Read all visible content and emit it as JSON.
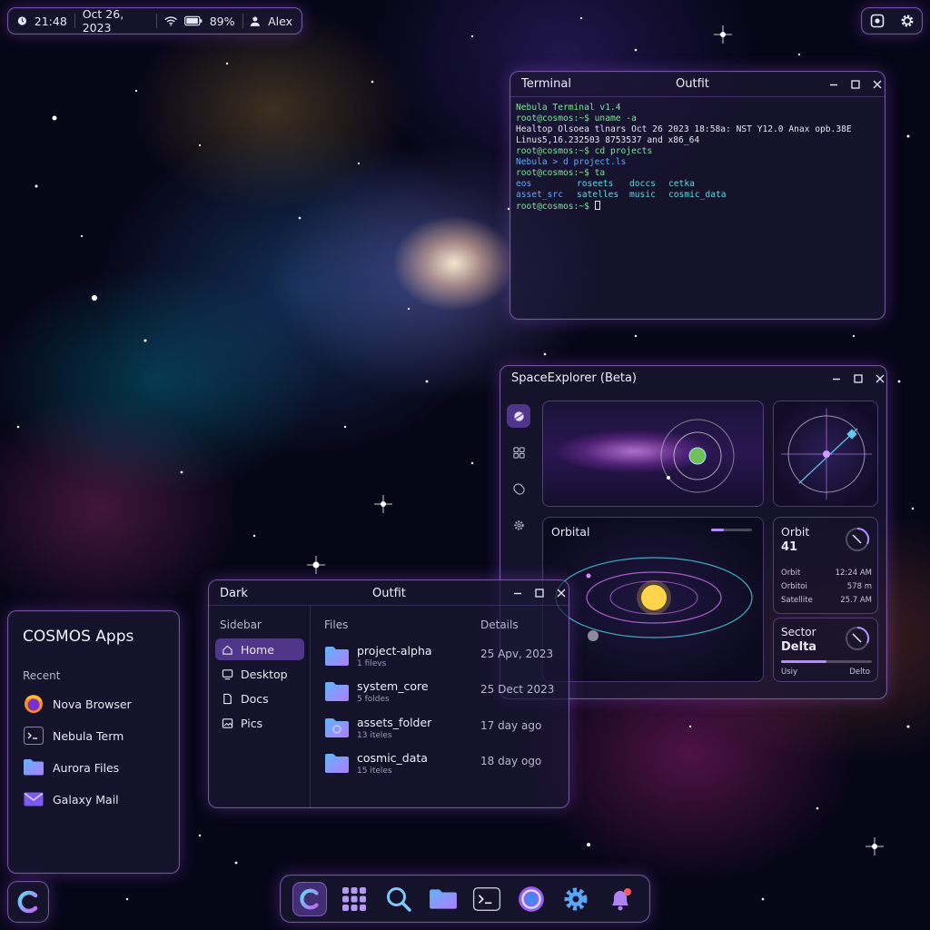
{
  "status_bar": {
    "time": "21:48",
    "date": "Oct 26, 2023",
    "battery": "89%",
    "user": "Alex"
  },
  "terminal": {
    "title_left": "Terminal",
    "title_center": "Outfit",
    "lines": {
      "l1": "Nebula Terminal v1.4",
      "l2": "root@cosmos:~$ uname -a",
      "l3": "Healtop Olsoea tlnars Oct 26 2023 18:58a: NST Y12.0 Anax opb.38E",
      "l4": "Linus5,16.232503 8753537 and x86_64",
      "l5": "root@cosmos:~$ cd projects",
      "l6": "Nebula > d project.ls",
      "l7": "root@cosmos:~$ ta",
      "l8_a": "eos",
      "l8_b": "roseets",
      "l8_c": "doccs",
      "l8_d": "cetka",
      "l9_a": "asset_src",
      "l9_b": "satelles",
      "l9_c": "music",
      "l9_d": "cosmic_data",
      "l10": "root@cosmos:~$ "
    }
  },
  "space_explorer": {
    "title": "SpaceExplorer (Beta)",
    "orbital_label": "Orbital",
    "orbit_card": {
      "title": "Orbit",
      "value": "41",
      "rows": [
        {
          "label": "Orbit",
          "value": "12:24 AM"
        },
        {
          "label": "Orbitoi",
          "value": "578 m"
        },
        {
          "label": "Satellite",
          "value": "25.7 AM"
        }
      ]
    },
    "sector_card": {
      "title": "Sector",
      "value": "Delta",
      "progress": 0.5,
      "foot_left": "Usiy",
      "foot_right": "Delto"
    }
  },
  "files_window": {
    "title_left": "Dark",
    "title_center": "Outfit",
    "sidebar_header": "Sidebar",
    "sidebar_items": [
      "Home",
      "Desktop",
      "Docs",
      "Pics"
    ],
    "col_files": "Files",
    "col_details": "Details",
    "files": [
      {
        "name": "project-alpha",
        "sub": "1 filevs",
        "date": "25 Apv, 2023"
      },
      {
        "name": "system_core",
        "sub": "5 foldes",
        "date": "25 Dect 2023"
      },
      {
        "name": "assets_folder",
        "sub": "13 iteles",
        "date": "17 day ago"
      },
      {
        "name": "cosmic_data",
        "sub": "15 iteles",
        "date": "18 day ogo"
      }
    ]
  },
  "apps_panel": {
    "title": "COSMOS Apps",
    "section": "Recent",
    "apps": [
      "Nova Browser",
      "Nebula Term",
      "Aurora Files",
      "Galaxy Mail"
    ]
  },
  "dock": {
    "items": [
      "cosmos-launcher",
      "app-grid",
      "search",
      "files",
      "terminal",
      "browser",
      "settings",
      "notifications"
    ]
  },
  "colors": {
    "accent": "#a070ff",
    "window_border": "#be8cff",
    "folder": "#b07cff",
    "orbit_cyan": "#45d6e6"
  }
}
